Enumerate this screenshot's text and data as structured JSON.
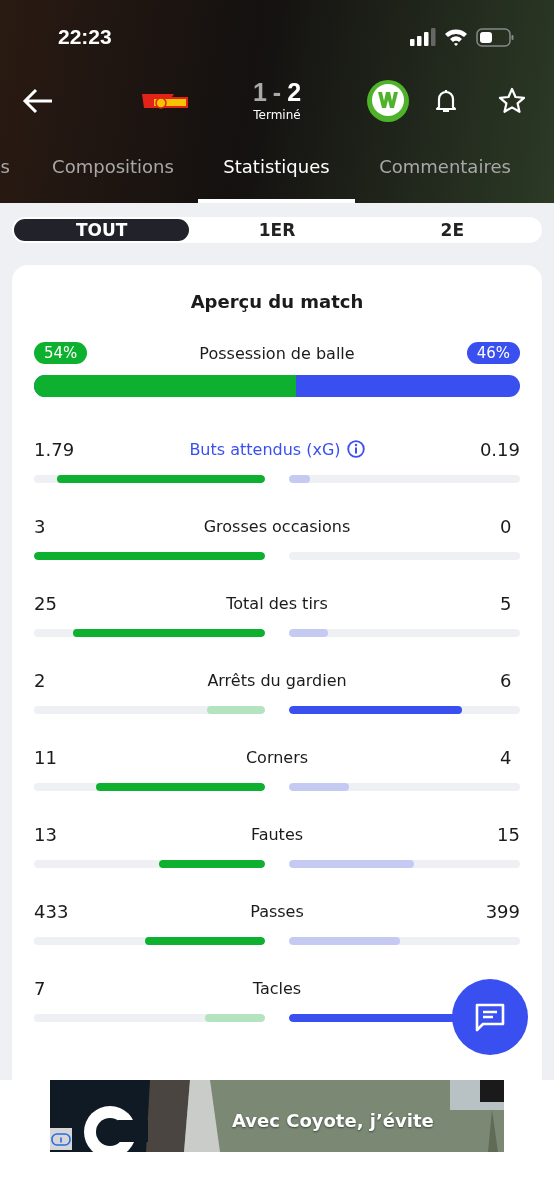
{
  "status_bar": {
    "time": "22:23"
  },
  "match": {
    "score_home": "1",
    "score_separator": "-",
    "score_away": "2",
    "status": "Terminé"
  },
  "tabs": [
    {
      "label": "s",
      "selected": false
    },
    {
      "label": "Compositions",
      "selected": false
    },
    {
      "label": "Statistiques",
      "selected": true
    },
    {
      "label": "Commentaires",
      "selected": false
    }
  ],
  "periods": [
    {
      "label": "TOUT",
      "selected": true
    },
    {
      "label": "1ER",
      "selected": false
    },
    {
      "label": "2E",
      "selected": false
    }
  ],
  "card": {
    "title": "Aperçu du match",
    "possession": {
      "label": "Possession de balle",
      "home": "54%",
      "away": "46%",
      "level": 0.54
    },
    "stats": [
      {
        "label": "Buts attendus (xG)",
        "kind": "info",
        "home": {
          "value": "1.79",
          "level": 0.9,
          "highlighted": true
        },
        "away": {
          "value": "0.19",
          "level": 0.09,
          "highlighted": false
        }
      },
      {
        "label": "Grosses occasions",
        "kind": "plain",
        "home": {
          "value": "3",
          "level": 1,
          "highlighted": true
        },
        "away": {
          "value": "0"
        }
      },
      {
        "label": "Total des tirs",
        "kind": "plain",
        "home": {
          "value": "25",
          "level": 0.83,
          "highlighted": true
        },
        "away": {
          "value": "5",
          "level": 0.17,
          "highlighted": false
        }
      },
      {
        "label": "Arrêts du gardien",
        "kind": "plain",
        "home": {
          "value": "2",
          "level": 0.25,
          "highlighted": false
        },
        "away": {
          "value": "6",
          "level": 0.75,
          "highlighted": true
        }
      },
      {
        "label": "Corners",
        "kind": "plain",
        "home": {
          "value": "11",
          "level": 0.73,
          "highlighted": true
        },
        "away": {
          "value": "4",
          "level": 0.26,
          "highlighted": false
        }
      },
      {
        "label": "Fautes",
        "kind": "plain",
        "home": {
          "value": "13",
          "level": 0.46,
          "highlighted": true
        },
        "away": {
          "value": "15",
          "level": 0.54,
          "highlighted": false
        }
      },
      {
        "label": "Passes",
        "kind": "plain",
        "home": {
          "value": "433",
          "level": 0.52,
          "highlighted": true
        },
        "away": {
          "value": "399",
          "level": 0.48,
          "highlighted": false
        }
      },
      {
        "label": "Tacles",
        "kind": "plain",
        "home": {
          "value": "7",
          "level": 0.26,
          "highlighted": false
        },
        "away": {
          "level": 0.74,
          "highlighted": true
        }
      }
    ]
  },
  "ad": {
    "headline": "Avec Coyote, j’évite"
  }
}
